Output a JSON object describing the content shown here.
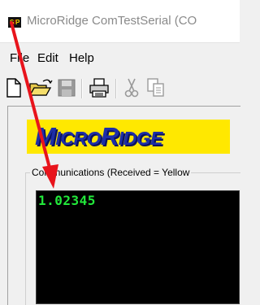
{
  "window": {
    "title": "MicroRidge ComTestSerial (CO",
    "icon_text": "S/P"
  },
  "menu": {
    "items": [
      "File",
      "Edit",
      "Help"
    ]
  },
  "toolbar": {
    "buttons": [
      "new-document-icon",
      "open-folder-icon",
      "save-icon",
      "print-icon",
      "cut-icon",
      "copy-icon"
    ]
  },
  "logo": {
    "text_large_1": "M",
    "text_small_1": "ICRO",
    "text_large_2": "R",
    "text_small_2": "IDGE"
  },
  "communications": {
    "label": "Communications  (Received = Yellow",
    "received_value": "1.02345"
  },
  "colors": {
    "terminal_bg": "#000000",
    "terminal_text": "#22e83a",
    "logo_bg": "#ffe800",
    "logo_text": "#1d2ea8",
    "annotation_arrow": "#e8141c"
  }
}
